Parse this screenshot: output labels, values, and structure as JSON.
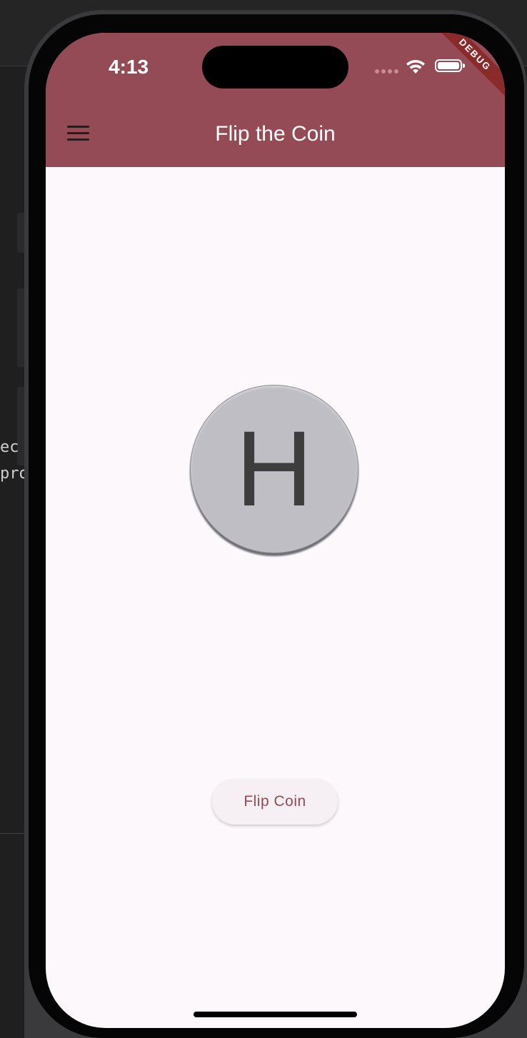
{
  "status_bar": {
    "time": "4:13",
    "signal_icon": "cellular-signal-icon",
    "wifi_icon": "wifi-icon",
    "battery_icon": "battery-icon"
  },
  "debug_banner": "DEBUG",
  "app_bar": {
    "menu_icon": "hamburger-menu-icon",
    "title": "Flip the Coin",
    "color": "#954b55"
  },
  "coin": {
    "face": "H"
  },
  "flip_button": {
    "label": "Flip Coin",
    "color": "#954b55"
  },
  "background_editor": {
    "code_line_1": "ec",
    "code_line_2": "pro"
  }
}
